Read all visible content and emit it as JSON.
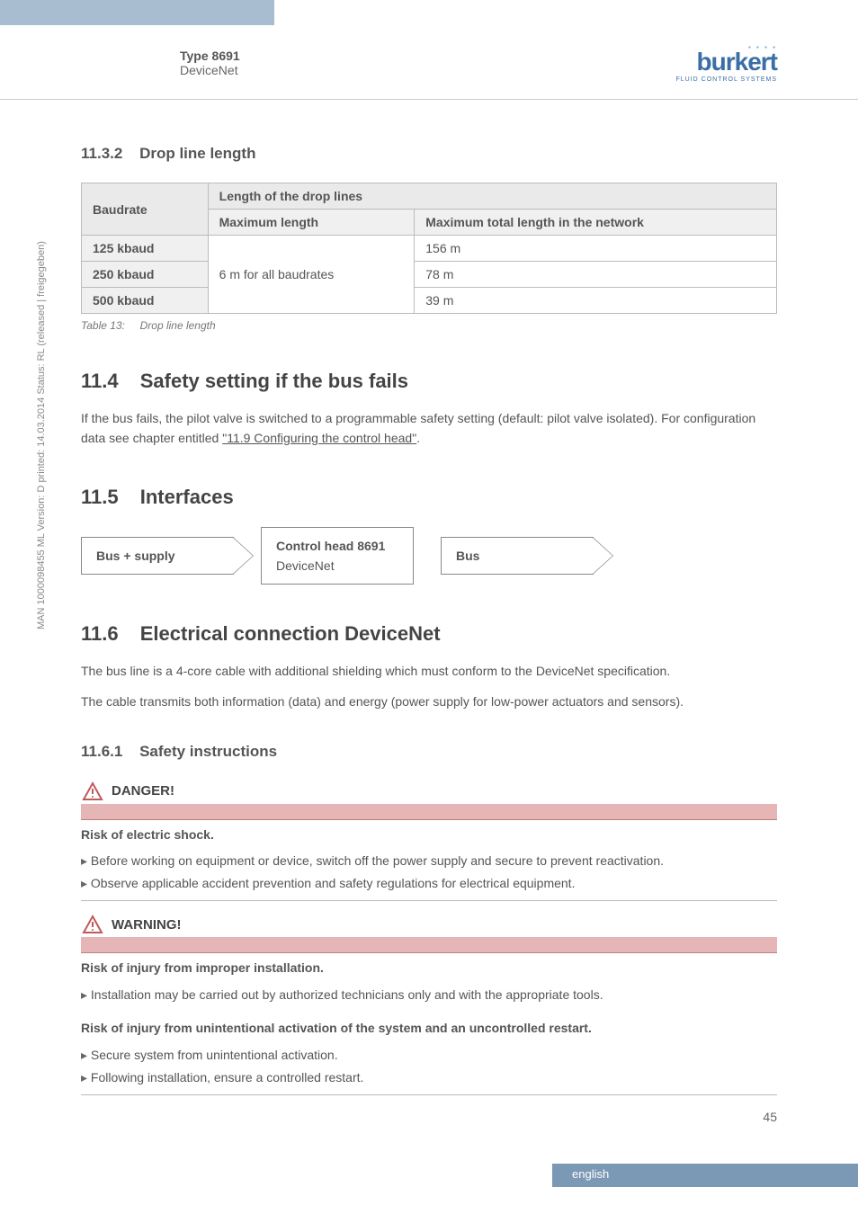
{
  "header": {
    "type_label": "Type 8691",
    "subtitle": "DeviceNet",
    "logo_text": "burkert",
    "logo_sub": "FLUID CONTROL SYSTEMS"
  },
  "side_text": "MAN 1000098455 ML Version: D  printed: 14.03.2014 Status: RL (released | freigegeben)",
  "s11_3_2": {
    "num": "11.3.2",
    "title": "Drop line length",
    "table": {
      "col_baudrate": "Baudrate",
      "col_span": "Length of the drop lines",
      "col_max": "Maximum length",
      "col_total": "Maximum total length in the network",
      "rows": [
        {
          "baud": "125 kbaud",
          "total": "156 m"
        },
        {
          "baud": "250 kbaud",
          "total": "78 m"
        },
        {
          "baud": "500 kbaud",
          "total": "39 m"
        }
      ],
      "max_shared": "6 m for all baudrates"
    },
    "caption_label": "Table 13:",
    "caption_text": "Drop line length"
  },
  "s11_4": {
    "num": "11.4",
    "title": "Safety setting if the bus fails",
    "para_a": "If the bus fails, the pilot valve is switched to a programmable safety setting (default: pilot valve isolated). For configuration data see chapter entitled ",
    "link": "\"11.9 Configuring the control head\"",
    "para_b": "."
  },
  "s11_5": {
    "num": "11.5",
    "title": "Interfaces",
    "box1": "Bus + supply",
    "box2a": "Control head 8691",
    "box2b": "DeviceNet",
    "box3": "Bus"
  },
  "s11_6": {
    "num": "11.6",
    "title": "Electrical connection DeviceNet",
    "p1": "The bus line is a 4-core cable with additional shielding which must conform to the DeviceNet specification.",
    "p2": "The cable transmits both information (data) and energy (power supply for low-power actuators and sensors)."
  },
  "s11_6_1": {
    "num": "11.6.1",
    "title": "Safety instructions",
    "danger": {
      "title": "DANGER!",
      "sub": "Risk of electric shock.",
      "items": [
        "Before working on equipment or device, switch off the power supply and secure to prevent reactivation.",
        "Observe applicable accident prevention and safety regulations for electrical equipment."
      ]
    },
    "warning": {
      "title": "WARNING!",
      "sub1": "Risk of injury from improper installation.",
      "items1": [
        "Installation may be carried out by authorized technicians only and with the appropriate tools."
      ],
      "sub2": "Risk of injury from unintentional activation of the system and an uncontrolled restart.",
      "items2": [
        "Secure system from unintentional activation.",
        "Following installation, ensure a controlled restart."
      ]
    }
  },
  "page_number": "45",
  "footer_lang": "english"
}
